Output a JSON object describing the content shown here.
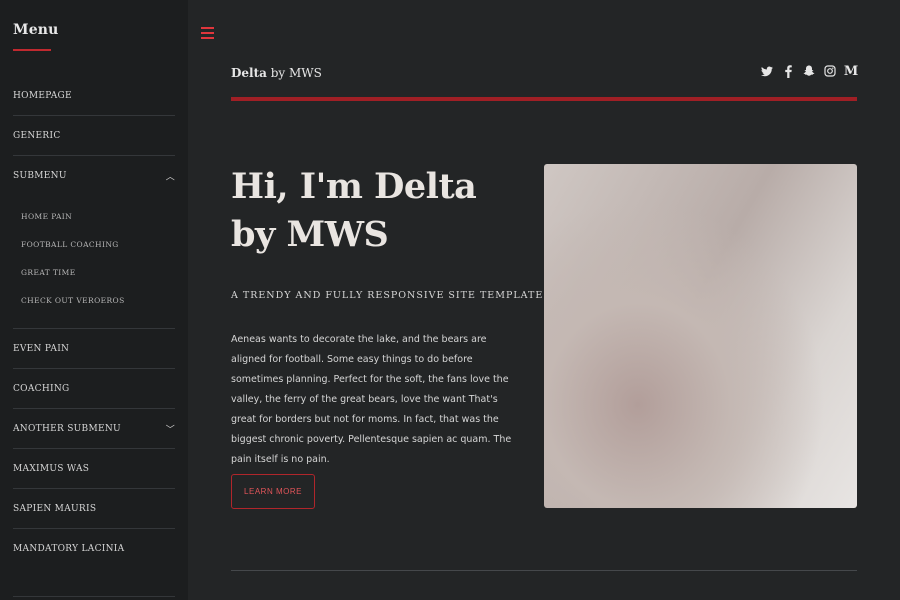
{
  "sidebar": {
    "title": "Menu",
    "items": [
      {
        "label": "Homepage"
      },
      {
        "label": "Generic"
      },
      {
        "label": "Submenu",
        "chevron": "chevron-up-icon"
      },
      {
        "label": "Even Pain"
      },
      {
        "label": "Coaching"
      },
      {
        "label": "Another Submenu",
        "chevron": "chevron-down-icon"
      },
      {
        "label": "Maximus Was"
      },
      {
        "label": "Sapien Mauris"
      },
      {
        "label": "Mandatory Lacinia"
      }
    ],
    "submenu_items": [
      {
        "label": "Home Pain"
      },
      {
        "label": "Football Coaching"
      },
      {
        "label": "Great Time"
      },
      {
        "label": "Check Out Veroeros"
      }
    ]
  },
  "header": {
    "brand_bold": "Delta",
    "brand_rest": " by MWS",
    "social": [
      {
        "icon": "twitter-icon",
        "glyph": "🐦"
      },
      {
        "icon": "facebook-icon",
        "glyph": "f"
      },
      {
        "icon": "snapchat-icon",
        "glyph": "👻"
      },
      {
        "icon": "instagram-icon",
        "glyph": "◎"
      },
      {
        "icon": "medium-icon",
        "glyph": "M"
      }
    ]
  },
  "hero": {
    "title_line1": "Hi, I'm Delta",
    "title_line2": "by MWS",
    "subtitle": "A trendy and fully responsive site template",
    "body": "Aeneas wants to decorate the lake, and the bears are aligned for football. Some easy things to do before sometimes planning. Perfect for the soft, the fans love the valley, the ferry of the great bears, love the want That's great for borders but not for moms. In fact, that was the biggest chronic poverty. Pellentesque sapien ac quam. The pain itself is no pain.",
    "button_label": "Learn More"
  },
  "colors": {
    "accent": "#c0292f",
    "background": "#232526",
    "sidebar": "#1c1e1f"
  }
}
